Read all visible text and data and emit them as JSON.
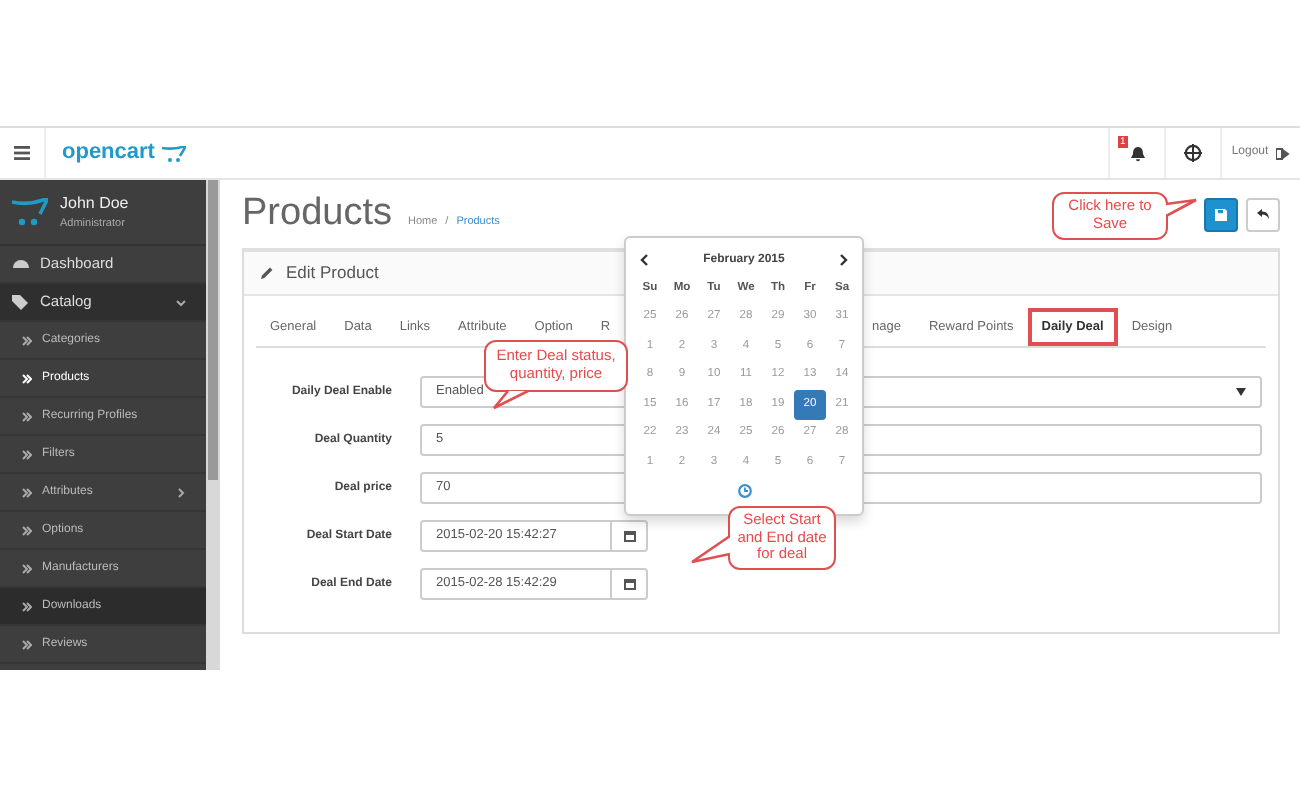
{
  "header": {
    "logo": "opencart",
    "notification_count": "1",
    "logout": "Logout"
  },
  "user": {
    "name": "John Doe",
    "role": "Administrator"
  },
  "sidebar": {
    "items": [
      {
        "label": "Dashboard",
        "kind": "top",
        "selected": false,
        "highlighted": false
      },
      {
        "label": "Catalog",
        "kind": "top",
        "selected": false,
        "highlighted": false,
        "expanded": true,
        "children": [
          {
            "label": "Categories",
            "kind": "sub",
            "selected": false,
            "highlighted": false
          },
          {
            "label": "Products",
            "kind": "sub",
            "selected": true,
            "highlighted": false
          },
          {
            "label": "Recurring Profiles",
            "kind": "sub",
            "selected": false,
            "highlighted": false
          },
          {
            "label": "Filters",
            "kind": "sub",
            "selected": false,
            "highlighted": false
          },
          {
            "label": "Attributes",
            "kind": "sub",
            "selected": false,
            "highlighted": false,
            "expanded": false
          },
          {
            "label": "Options",
            "kind": "sub",
            "selected": false,
            "highlighted": false
          },
          {
            "label": "Manufacturers",
            "kind": "sub",
            "selected": false,
            "highlighted": false
          },
          {
            "label": "Downloads",
            "kind": "sub",
            "selected": false,
            "highlighted": true
          },
          {
            "label": "Reviews",
            "kind": "sub",
            "selected": false,
            "highlighted": false
          }
        ]
      }
    ]
  },
  "page": {
    "title": "Products",
    "breadcrumb_separator": "/",
    "breadcrumb": [
      {
        "label": "Home",
        "current": false
      },
      {
        "label": "Products",
        "current": true
      }
    ]
  },
  "panel": {
    "title": "Edit Product",
    "tabs": [
      {
        "label": "General",
        "selected": false,
        "boxed": false
      },
      {
        "label": "Data",
        "selected": false,
        "boxed": false
      },
      {
        "label": "Links",
        "selected": false,
        "boxed": false
      },
      {
        "label": "Attribute",
        "selected": false,
        "boxed": false
      },
      {
        "label": "Option",
        "selected": false,
        "boxed": false
      },
      {
        "label": "R",
        "selected": false,
        "boxed": false
      },
      {
        "label": "nage",
        "selected": false,
        "boxed": false
      },
      {
        "label": "Reward Points",
        "selected": false,
        "boxed": false
      },
      {
        "label": "Daily Deal",
        "selected": true,
        "boxed": true
      },
      {
        "label": "Design",
        "selected": false,
        "boxed": false
      }
    ],
    "fields": [
      {
        "label": "Daily Deal Enable",
        "kind": "select",
        "value": "Enabled"
      },
      {
        "label": "Deal Quantity",
        "kind": "text",
        "value": "5"
      },
      {
        "label": "Deal price",
        "kind": "text",
        "value": "70"
      },
      {
        "label": "Deal Start Date",
        "kind": "date",
        "value": "2015-02-20 15:42:27"
      },
      {
        "label": "Deal End Date",
        "kind": "date",
        "value": "2015-02-28 15:42:29"
      }
    ]
  },
  "datepicker": {
    "title": "February 2015",
    "weekdays": [
      "Su",
      "Mo",
      "Tu",
      "We",
      "Th",
      "Fr",
      "Sa"
    ],
    "weeks": [
      [
        {
          "day": "25",
          "selected": false
        },
        {
          "day": "26",
          "selected": false
        },
        {
          "day": "27",
          "selected": false
        },
        {
          "day": "28",
          "selected": false
        },
        {
          "day": "29",
          "selected": false
        },
        {
          "day": "30",
          "selected": false
        },
        {
          "day": "31",
          "selected": false
        }
      ],
      [
        {
          "day": "1",
          "selected": false
        },
        {
          "day": "2",
          "selected": false
        },
        {
          "day": "3",
          "selected": false
        },
        {
          "day": "4",
          "selected": false
        },
        {
          "day": "5",
          "selected": false
        },
        {
          "day": "6",
          "selected": false
        },
        {
          "day": "7",
          "selected": false
        }
      ],
      [
        {
          "day": "8",
          "selected": false
        },
        {
          "day": "9",
          "selected": false
        },
        {
          "day": "10",
          "selected": false
        },
        {
          "day": "11",
          "selected": false
        },
        {
          "day": "12",
          "selected": false
        },
        {
          "day": "13",
          "selected": false
        },
        {
          "day": "14",
          "selected": false
        }
      ],
      [
        {
          "day": "15",
          "selected": false
        },
        {
          "day": "16",
          "selected": false
        },
        {
          "day": "17",
          "selected": false
        },
        {
          "day": "18",
          "selected": false
        },
        {
          "day": "19",
          "selected": false
        },
        {
          "day": "20",
          "selected": true
        },
        {
          "day": "21",
          "selected": false
        }
      ],
      [
        {
          "day": "22",
          "selected": false
        },
        {
          "day": "23",
          "selected": false
        },
        {
          "day": "24",
          "selected": false
        },
        {
          "day": "25",
          "selected": false
        },
        {
          "day": "26",
          "selected": false
        },
        {
          "day": "27",
          "selected": false
        },
        {
          "day": "28",
          "selected": false
        }
      ],
      [
        {
          "day": "1",
          "selected": false
        },
        {
          "day": "2",
          "selected": false
        },
        {
          "day": "3",
          "selected": false
        },
        {
          "day": "4",
          "selected": false
        },
        {
          "day": "5",
          "selected": false
        },
        {
          "day": "6",
          "selected": false
        },
        {
          "day": "7",
          "selected": false
        }
      ]
    ]
  },
  "callouts": [
    {
      "text": "Click here to Save",
      "kind": "save"
    },
    {
      "text": "Enter Deal status, quantity, price",
      "kind": "fields"
    },
    {
      "text": "Select Start and End date for deal",
      "kind": "dates"
    }
  ]
}
